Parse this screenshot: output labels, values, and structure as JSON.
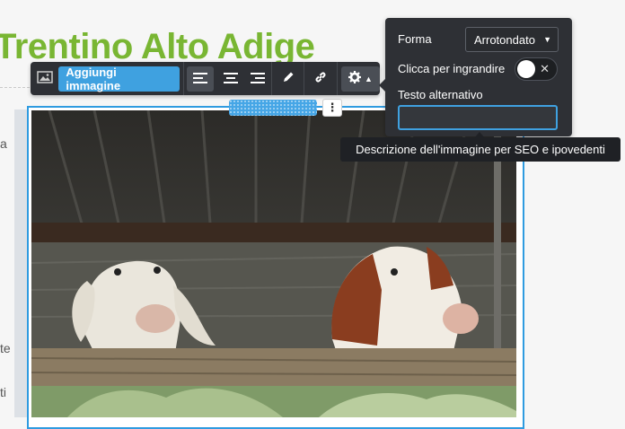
{
  "page": {
    "title": "Trentino Alto Adige",
    "left_fragments": [
      "a",
      "te",
      "ti"
    ]
  },
  "toolbar": {
    "add_image_label": "Aggiungi immagine",
    "icons": [
      "image-icon",
      "align-left-icon",
      "align-center-icon",
      "align-right-icon",
      "pencil-icon",
      "link-icon",
      "gear-icon",
      "caret-up-icon"
    ],
    "active_align": "left"
  },
  "settings_panel": {
    "shape_label": "Forma",
    "shape_value": "Arrotondato",
    "zoom_label": "Clicca per ingrandire",
    "zoom_toggle_on": false,
    "alt_label": "Testo alternativo",
    "alt_value": "",
    "alt_placeholder": ""
  },
  "tooltip": {
    "text": "Descrizione dell'immagine per SEO e ipovedenti"
  },
  "image_block": {
    "more_icon": "vertical-dots-icon",
    "image_subject": "two goats behind a wooden fence"
  },
  "colors": {
    "title_green": "#79b633",
    "toolbar_bg": "#2e3035",
    "accent_blue": "#3fa1e0",
    "tooltip_bg": "#1f2125"
  }
}
